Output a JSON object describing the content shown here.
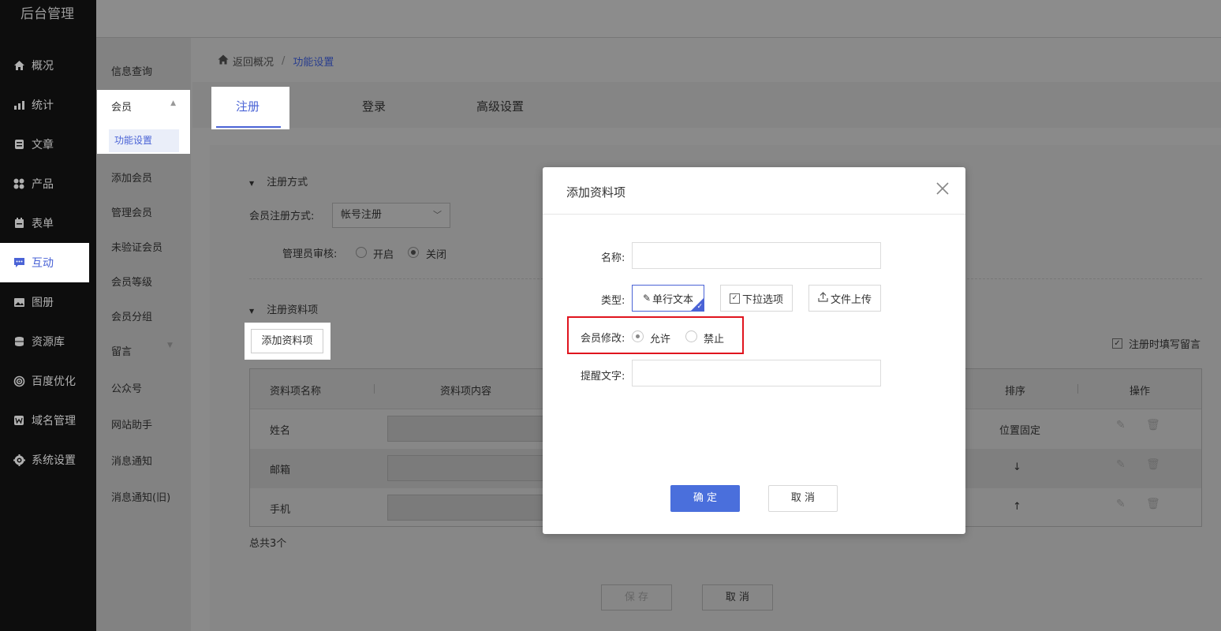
{
  "app": {
    "title": "后台管理"
  },
  "sidebar": {
    "items": [
      {
        "label": "概况",
        "icon": "home-icon"
      },
      {
        "label": "统计",
        "icon": "chart-icon"
      },
      {
        "label": "文章",
        "icon": "article-icon"
      },
      {
        "label": "产品",
        "icon": "grid-icon"
      },
      {
        "label": "表单",
        "icon": "form-icon"
      },
      {
        "label": "互动",
        "icon": "chat-icon",
        "active": true
      },
      {
        "label": "图册",
        "icon": "gallery-icon"
      },
      {
        "label": "资源库",
        "icon": "database-icon"
      },
      {
        "label": "百度优化",
        "icon": "target-icon"
      },
      {
        "label": "域名管理",
        "icon": "domain-icon"
      },
      {
        "label": "系统设置",
        "icon": "gear-icon"
      }
    ]
  },
  "subnav": {
    "info": "信息查询",
    "member": "会员",
    "member_selected": "功能设置",
    "add_member": "添加会员",
    "manage_member": "管理会员",
    "unverified": "未验证会员",
    "level": "会员等级",
    "group": "会员分组",
    "message": "留言",
    "wechat": "公众号",
    "assistant": "网站助手",
    "notify": "消息通知",
    "notify_old": "消息通知(旧)"
  },
  "breadcrumb": {
    "back": "返回概况",
    "sep": "/",
    "current": "功能设置"
  },
  "tabs": {
    "register": "注册",
    "login": "登录",
    "advanced": "高级设置"
  },
  "register_method": {
    "title": "注册方式",
    "method_label": "会员注册方式:",
    "method_value": "帐号注册",
    "review_label": "管理员审核:",
    "opt_on": "开启",
    "opt_off": "关闭",
    "selected": "关闭"
  },
  "register_fields": {
    "title": "注册资料项",
    "add_button": "添加资料项",
    "checkbox_label": "注册时填写留言",
    "checkbox_checked": true,
    "columns": {
      "name": "资料项名称",
      "content": "资料项内容",
      "sort": "排序",
      "ops": "操作"
    },
    "rows": [
      {
        "name": "姓名",
        "sort": "位置固定"
      },
      {
        "name": "邮箱",
        "sort": "↓"
      },
      {
        "name": "手机",
        "sort": "↑"
      }
    ],
    "total": "总共3个"
  },
  "footer": {
    "save": "保 存",
    "cancel": "取 消"
  },
  "modal": {
    "title": "添加资料项",
    "name_label": "名称:",
    "type_label": "类型:",
    "types": {
      "single": "单行文本",
      "dropdown": "下拉选项",
      "upload": "文件上传"
    },
    "type_selected": "单行文本",
    "modify_label": "会员修改:",
    "allow": "允许",
    "forbid": "禁止",
    "modify_selected": "允许",
    "hint_label": "提醒文字:",
    "ok": "确 定",
    "cancel": "取 消"
  },
  "colors": {
    "accent": "#4a63d6",
    "highlight": "#e0141e",
    "ok_button": "#4a6fdc"
  }
}
